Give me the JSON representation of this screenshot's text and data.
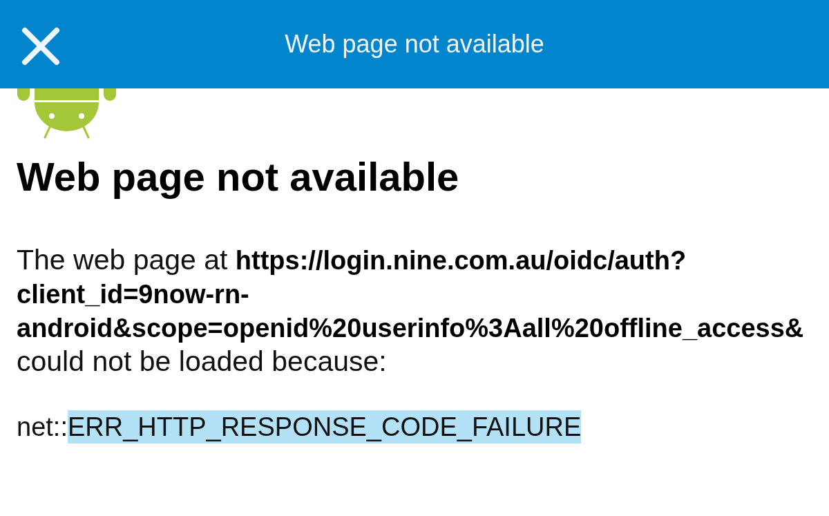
{
  "app_bar": {
    "title": "Web page not available"
  },
  "error_page": {
    "heading": "Web page not available",
    "message": "The web page at **https://login.nine.com.au/oidc/auth?client_id=9now-rn-android&scope=openid%20userinfo%3Aall%20offline_access&** could not be loaded because:",
    "error": {
      "prefix": "net::",
      "code": "ERR_HTTP_RESPONSE_CODE_FAILURE",
      "selected": true
    }
  }
}
